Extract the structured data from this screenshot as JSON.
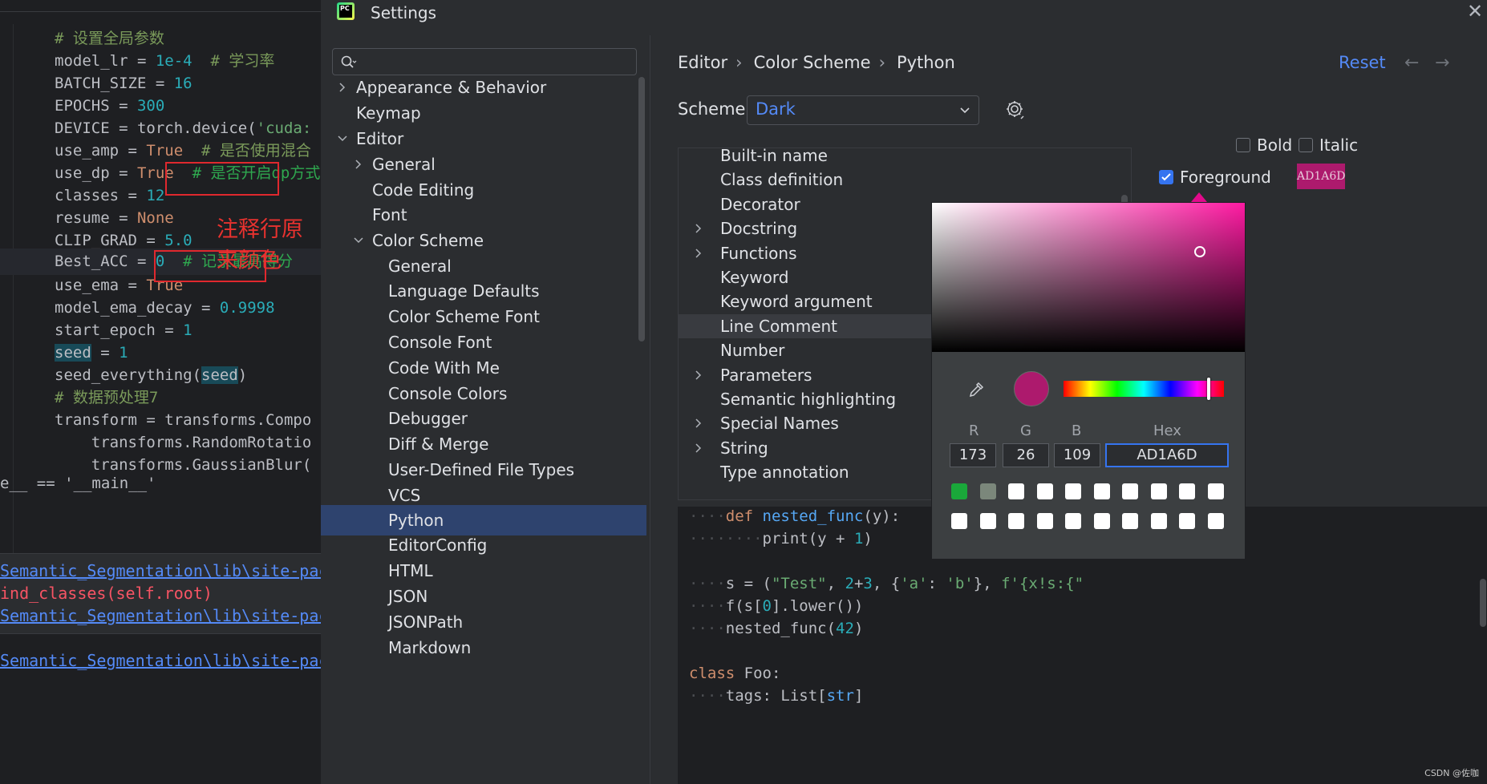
{
  "code": {
    "lines": [
      {
        "parts": [
          [
            "# ",
            "t-cm"
          ],
          [
            "设置全局参数",
            "t-cm"
          ]
        ]
      },
      {
        "parts": [
          [
            "model_lr",
            "t-id"
          ],
          [
            " = ",
            "t-id"
          ],
          [
            "1e-4",
            "t-num"
          ],
          [
            "  # 学习率",
            "t-cm"
          ]
        ]
      },
      {
        "parts": [
          [
            "BATCH_SIZE",
            "t-id"
          ],
          [
            " = ",
            "t-id"
          ],
          [
            "16",
            "t-num"
          ]
        ]
      },
      {
        "parts": [
          [
            "EPOCHS",
            "t-id"
          ],
          [
            " = ",
            "t-id"
          ],
          [
            "300",
            "t-num"
          ]
        ]
      },
      {
        "parts": [
          [
            "DEVICE",
            "t-id"
          ],
          [
            " = torch.device(",
            "t-id"
          ],
          [
            "'cuda:",
            "t-str"
          ]
        ]
      },
      {
        "parts": [
          [
            "use_amp",
            "t-id"
          ],
          [
            " = ",
            "t-id"
          ],
          [
            "True",
            "t-kw"
          ],
          [
            "  # 是否使用混合",
            "t-cm"
          ]
        ]
      },
      {
        "parts": [
          [
            "use_dp",
            "t-id"
          ],
          [
            " = ",
            "t-id"
          ],
          [
            "True",
            "t-kw"
          ],
          [
            "  # 是否开启dp方式",
            "t-cm2"
          ]
        ]
      },
      {
        "parts": [
          [
            "classes",
            "t-id"
          ],
          [
            " = ",
            "t-id"
          ],
          [
            "12",
            "t-num"
          ]
        ]
      },
      {
        "parts": [
          [
            "resume",
            "t-id"
          ],
          [
            " = ",
            "t-id"
          ],
          [
            "None",
            "t-kw"
          ]
        ]
      },
      {
        "parts": [
          [
            "CLIP_GRAD",
            "t-id"
          ],
          [
            " = ",
            "t-id"
          ],
          [
            "5.0",
            "t-num"
          ]
        ]
      },
      {
        "parts": [
          [
            "Best_ACC",
            "t-id"
          ],
          [
            " = ",
            "t-id"
          ],
          [
            "0",
            "t-num"
          ],
          [
            "  # 记录最高得分",
            "t-cm2"
          ]
        ]
      },
      {
        "parts": [
          [
            "use_ema",
            "t-id"
          ],
          [
            " = ",
            "t-id"
          ],
          [
            "True",
            "t-kw"
          ]
        ]
      },
      {
        "parts": [
          [
            "model_ema_decay",
            "t-id"
          ],
          [
            " = ",
            "t-id"
          ],
          [
            "0.9998",
            "t-num"
          ]
        ]
      },
      {
        "parts": [
          [
            "start_epoch",
            "t-id"
          ],
          [
            " = ",
            "t-id"
          ],
          [
            "1",
            "t-num"
          ]
        ]
      },
      {
        "parts": [
          [
            "seed",
            "t-hl-var"
          ],
          [
            " = ",
            "t-id"
          ],
          [
            "1",
            "t-num"
          ]
        ]
      },
      {
        "parts": [
          [
            "seed_everything(",
            "t-id"
          ],
          [
            "seed",
            "t-hl-var"
          ],
          [
            ")",
            "t-id"
          ]
        ]
      },
      {
        "parts": [
          [
            "# 数据预处理7",
            "t-cm"
          ]
        ]
      },
      {
        "parts": [
          [
            "transform",
            "t-id"
          ],
          [
            " = transforms.Compo",
            "t-id"
          ]
        ]
      },
      {
        "parts": [
          [
            "    transforms.RandomRotatio",
            "t-id"
          ]
        ]
      },
      {
        "parts": [
          [
            "    transforms.GaussianBlur(",
            "t-id"
          ]
        ]
      }
    ],
    "annotation": "注释行原来颜色",
    "main_line": "e__ == '__main__'",
    "console": [
      {
        "text": "Semantic_Segmentation\\lib\\site-pac",
        "cls": "link"
      },
      {
        "text": "ind_classes(self.root)",
        "cls": "err"
      },
      {
        "text": "Semantic_Segmentation\\lib\\site-pac",
        "cls": "link"
      },
      {
        "text": "",
        "cls": ""
      },
      {
        "text": "Semantic_Segmentation\\lib\\site-pac",
        "cls": "link"
      }
    ]
  },
  "dialog": {
    "title": "Settings",
    "close": "✕",
    "search_placeholder": ""
  },
  "tree": [
    {
      "label": "Appearance & Behavior",
      "level": 0,
      "chev": "right"
    },
    {
      "label": "Keymap",
      "level": 0,
      "chev": ""
    },
    {
      "label": "Editor",
      "level": 0,
      "chev": "down"
    },
    {
      "label": "General",
      "level": 1,
      "chev": "right"
    },
    {
      "label": "Code Editing",
      "level": 1,
      "chev": ""
    },
    {
      "label": "Font",
      "level": 1,
      "chev": ""
    },
    {
      "label": "Color Scheme",
      "level": 1,
      "chev": "down"
    },
    {
      "label": "General",
      "level": 2,
      "chev": ""
    },
    {
      "label": "Language Defaults",
      "level": 2,
      "chev": ""
    },
    {
      "label": "Color Scheme Font",
      "level": 2,
      "chev": ""
    },
    {
      "label": "Console Font",
      "level": 2,
      "chev": ""
    },
    {
      "label": "Code With Me",
      "level": 2,
      "chev": ""
    },
    {
      "label": "Console Colors",
      "level": 2,
      "chev": ""
    },
    {
      "label": "Debugger",
      "level": 2,
      "chev": ""
    },
    {
      "label": "Diff & Merge",
      "level": 2,
      "chev": ""
    },
    {
      "label": "User-Defined File Types",
      "level": 2,
      "chev": ""
    },
    {
      "label": "VCS",
      "level": 2,
      "chev": ""
    },
    {
      "label": "Python",
      "level": 2,
      "chev": "",
      "selected": true
    },
    {
      "label": "EditorConfig",
      "level": 2,
      "chev": ""
    },
    {
      "label": "HTML",
      "level": 2,
      "chev": ""
    },
    {
      "label": "JSON",
      "level": 2,
      "chev": ""
    },
    {
      "label": "JSONPath",
      "level": 2,
      "chev": ""
    },
    {
      "label": "Markdown",
      "level": 2,
      "chev": ""
    }
  ],
  "breadcrumb": [
    "Editor",
    "Color Scheme",
    "Python"
  ],
  "breadcrumb_sep": "›",
  "reset": "Reset",
  "nav_back": "←",
  "nav_forward": "→",
  "scheme": {
    "label": "Scheme:",
    "value": "Dark"
  },
  "elements": [
    {
      "label": "Built-in name",
      "chev": false
    },
    {
      "label": "Class definition",
      "chev": false
    },
    {
      "label": "Decorator",
      "chev": false
    },
    {
      "label": "Docstring",
      "chev": true
    },
    {
      "label": "Functions",
      "chev": true
    },
    {
      "label": "Keyword",
      "chev": false
    },
    {
      "label": "Keyword argument",
      "chev": false
    },
    {
      "label": "Line Comment",
      "chev": false,
      "selected": true
    },
    {
      "label": "Number",
      "chev": false
    },
    {
      "label": "Parameters",
      "chev": true
    },
    {
      "label": "Semantic highlighting",
      "chev": false
    },
    {
      "label": "Special Names",
      "chev": true
    },
    {
      "label": "String",
      "chev": true
    },
    {
      "label": "Type annotation",
      "chev": false
    }
  ],
  "options": {
    "bold": {
      "label": "Bold",
      "checked": false
    },
    "italic": {
      "label": "Italic",
      "checked": false
    },
    "foreground": {
      "label": "Foreground",
      "checked": true,
      "value": "AD1A6D"
    }
  },
  "preview": [
    [
      [
        "····",
        "ws"
      ],
      [
        "def ",
        "t-kw"
      ],
      [
        "nested_func",
        "fn"
      ],
      [
        "(y):",
        "t-id"
      ]
    ],
    [
      [
        "········",
        "ws"
      ],
      [
        "print(y ",
        "t-id"
      ],
      [
        "+",
        "t-id"
      ],
      [
        " ",
        "t-id"
      ],
      [
        "1",
        "t-num"
      ],
      [
        ")",
        "t-id"
      ]
    ],
    [],
    [
      [
        "····",
        "ws"
      ],
      [
        "s = (",
        "t-id"
      ],
      [
        "\"Test\"",
        "t-str"
      ],
      [
        ", ",
        "t-id"
      ],
      [
        "2",
        "t-num"
      ],
      [
        "+",
        "t-id"
      ],
      [
        "3",
        "t-num"
      ],
      [
        ", {",
        "t-id"
      ],
      [
        "'a'",
        "t-str"
      ],
      [
        ": ",
        "t-id"
      ],
      [
        "'b'",
        "t-str"
      ],
      [
        "}, ",
        "t-id"
      ],
      [
        "f'{x!s:{\"",
        "t-str"
      ]
    ],
    [
      [
        "····",
        "ws"
      ],
      [
        "f(s[",
        "t-id"
      ],
      [
        "0",
        "t-num"
      ],
      [
        "].lower())",
        "t-id"
      ]
    ],
    [
      [
        "····",
        "ws"
      ],
      [
        "nested_func(",
        "t-id"
      ],
      [
        "42",
        "t-num"
      ],
      [
        ")",
        "t-id"
      ]
    ],
    [],
    [
      [
        "class ",
        "t-kw"
      ],
      [
        "Foo:",
        "t-id"
      ]
    ],
    [
      [
        "····",
        "ws"
      ],
      [
        "tags: List[",
        "t-id"
      ],
      [
        "str",
        "fn"
      ],
      [
        "]",
        "t-id"
      ]
    ]
  ],
  "picker": {
    "color": "#ad1a6d",
    "hue_fraction": 0.905,
    "channels": {
      "r_label": "R",
      "g_label": "G",
      "b_label": "B",
      "hex_label": "Hex",
      "r": "173",
      "g": "26",
      "b": "109",
      "hex": "AD1A6D"
    },
    "recent_colors": [
      "#1aa83a",
      "#7b877b",
      "#ffffff",
      "#ffffff",
      "#ffffff",
      "#ffffff",
      "#ffffff",
      "#ffffff",
      "#ffffff",
      "#ffffff",
      "#ffffff",
      "#ffffff",
      "#ffffff",
      "#ffffff",
      "#ffffff",
      "#ffffff",
      "#ffffff",
      "#ffffff",
      "#ffffff",
      "#ffffff"
    ]
  },
  "watermark": "CSDN @佐咖"
}
